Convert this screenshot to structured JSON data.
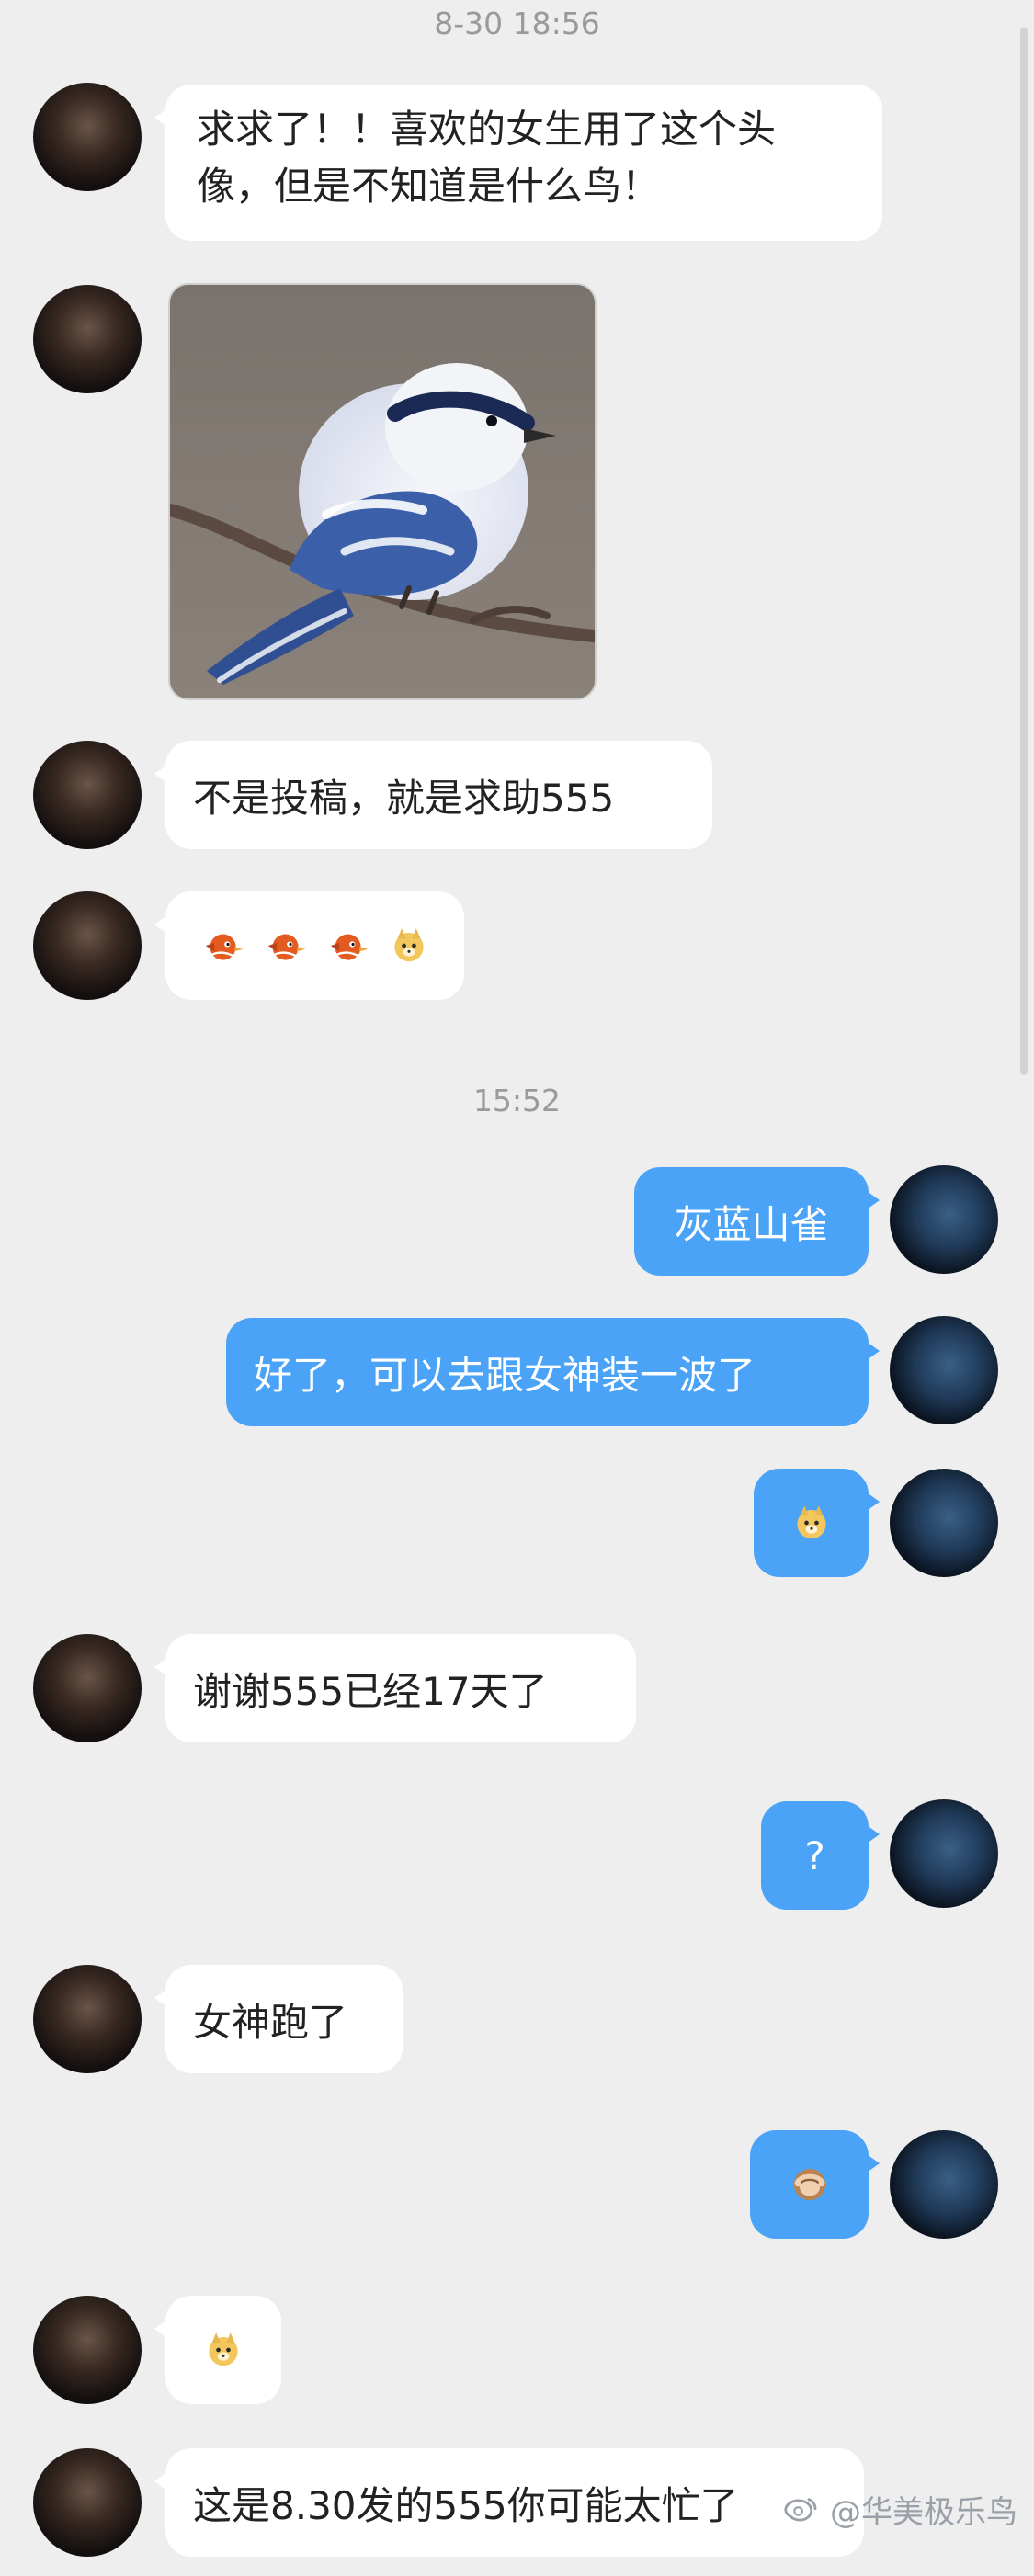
{
  "chat": {
    "time_1": "8-30 18:56",
    "time_2": "15:52",
    "messages": [
      {
        "side": "in",
        "type": "text",
        "text": "求求了！！喜欢的女生用了这个头像，但是不知道是什么鸟！"
      },
      {
        "side": "in",
        "type": "image",
        "alt": "bird photo"
      },
      {
        "side": "in",
        "type": "text",
        "text": "不是投稿，就是求助555"
      },
      {
        "side": "in",
        "type": "emoji",
        "emojis": [
          "bird",
          "bird",
          "bird",
          "dog"
        ]
      },
      {
        "side": "out",
        "type": "text",
        "text": "灰蓝山雀"
      },
      {
        "side": "out",
        "type": "text",
        "text": "好了，可以去跟女神装一波了"
      },
      {
        "side": "out",
        "type": "emoji",
        "emojis": [
          "dog"
        ]
      },
      {
        "side": "in",
        "type": "text",
        "text": "谢谢555已经17天了"
      },
      {
        "side": "out",
        "type": "text",
        "text": "?"
      },
      {
        "side": "in",
        "type": "text",
        "text": "女神跑了"
      },
      {
        "side": "out",
        "type": "emoji",
        "emojis": [
          "see-no-evil-monkey"
        ]
      },
      {
        "side": "in",
        "type": "emoji",
        "emojis": [
          "dog"
        ]
      },
      {
        "side": "in",
        "type": "text",
        "text": "这是8.30发的555你可能太忙了"
      }
    ]
  },
  "watermark": "@华美极乐鸟",
  "colors": {
    "outgoing_bubble": "#4aa3f6",
    "incoming_bubble": "#ffffff",
    "background": "#eeeeee"
  }
}
